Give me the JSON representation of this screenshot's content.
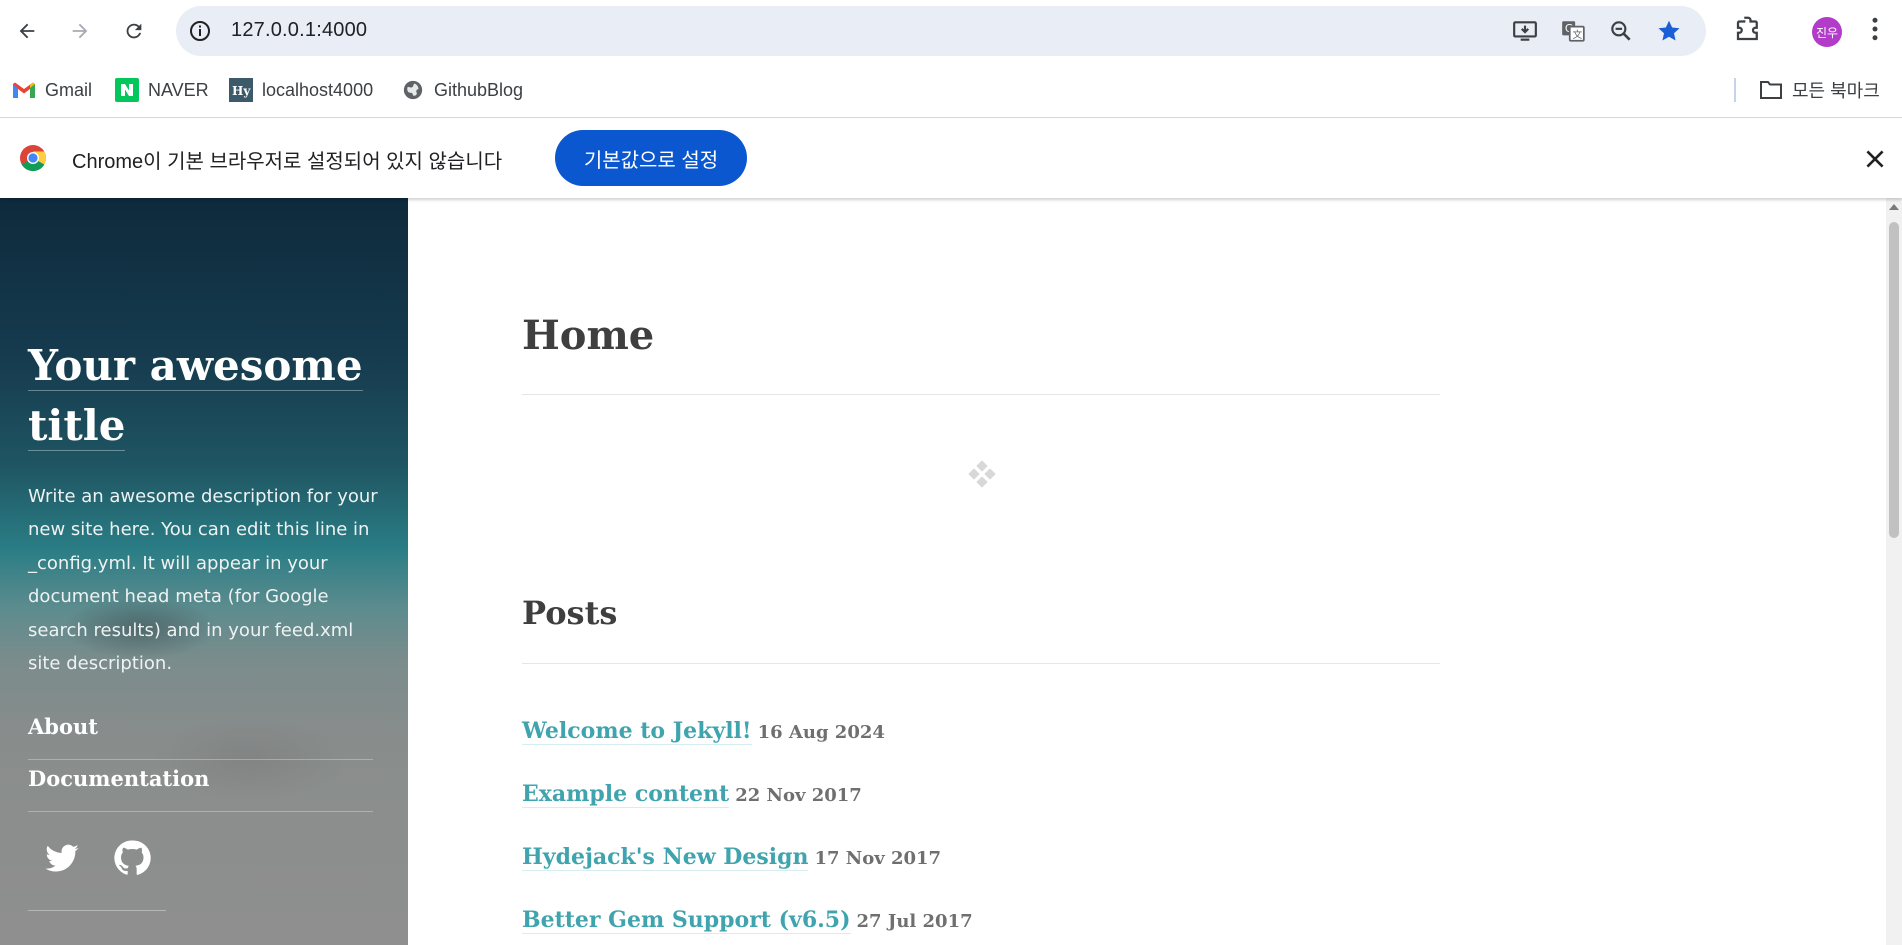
{
  "browser": {
    "url": "127.0.0.1:4000",
    "profile_initials": "진우",
    "bookmarks": [
      {
        "label": "Gmail",
        "icon": "gmail-icon"
      },
      {
        "label": "NAVER",
        "icon": "naver-icon"
      },
      {
        "label": "localhost4000",
        "icon": "hydejack-icon"
      },
      {
        "label": "GithubBlog",
        "icon": "globe-icon"
      }
    ],
    "all_bookmarks_label": "모든 북마크",
    "accent": "#0b57d0"
  },
  "infobar": {
    "message": "Chrome이 기본 브라우저로 설정되어 있지 않습니다",
    "button_label": "기본값으로 설정"
  },
  "sidebar": {
    "title_line1": "Your awesome",
    "title_line2": "title",
    "description": "Write an awesome description for your new site here. You can edit this line in _config.yml. It will appear in your document head meta (for Google search results) and in your feed.xml site description.",
    "nav": [
      {
        "label": "About"
      },
      {
        "label": "Documentation"
      }
    ],
    "social": [
      "twitter-icon",
      "github-icon"
    ]
  },
  "main": {
    "page_title": "Home",
    "posts_heading": "Posts",
    "link_color": "#3fa4ad",
    "posts": [
      {
        "title": "Welcome to Jekyll!",
        "date": "16 Aug 2024"
      },
      {
        "title": "Example content",
        "date": "22 Nov 2017"
      },
      {
        "title": "Hydejack's New Design",
        "date": "17 Nov 2017"
      },
      {
        "title": "Better Gem Support (v6.5)",
        "date": "27 Jul 2017"
      }
    ]
  }
}
